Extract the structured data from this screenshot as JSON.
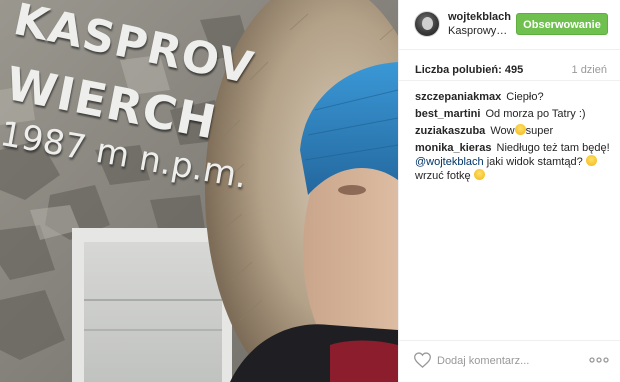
{
  "photo": {
    "sign_line1": "KASPROV",
    "sign_line2": "WIERCH",
    "sign_line3": "1987 m n.p.m."
  },
  "post": {
    "username": "wojtekblach",
    "location": "Kasprowy Wierch",
    "follow_label": "Obserwowanie",
    "likes_label": "Liczba polubień: 495",
    "time": "1 dzień"
  },
  "comments": [
    {
      "user": "szczepaniakmax",
      "text": "Ciepło?"
    },
    {
      "user": "best_martini",
      "text": "Od morza po Tatry :)"
    },
    {
      "user": "zuziakaszuba",
      "text": "Wow",
      "text_after": "super"
    },
    {
      "user": "monika_kieras",
      "text": "Niedługo też tam będę!",
      "mention": "@wojtekblach",
      "text2": "jaki widok stamtąd?",
      "text3": "wrzuć fotkę"
    }
  ],
  "footer": {
    "comment_placeholder": "Dodaj komentarz..."
  },
  "colors": {
    "follow_bg": "#70c050",
    "mention": "#003569",
    "hat": "#2f86c4"
  }
}
